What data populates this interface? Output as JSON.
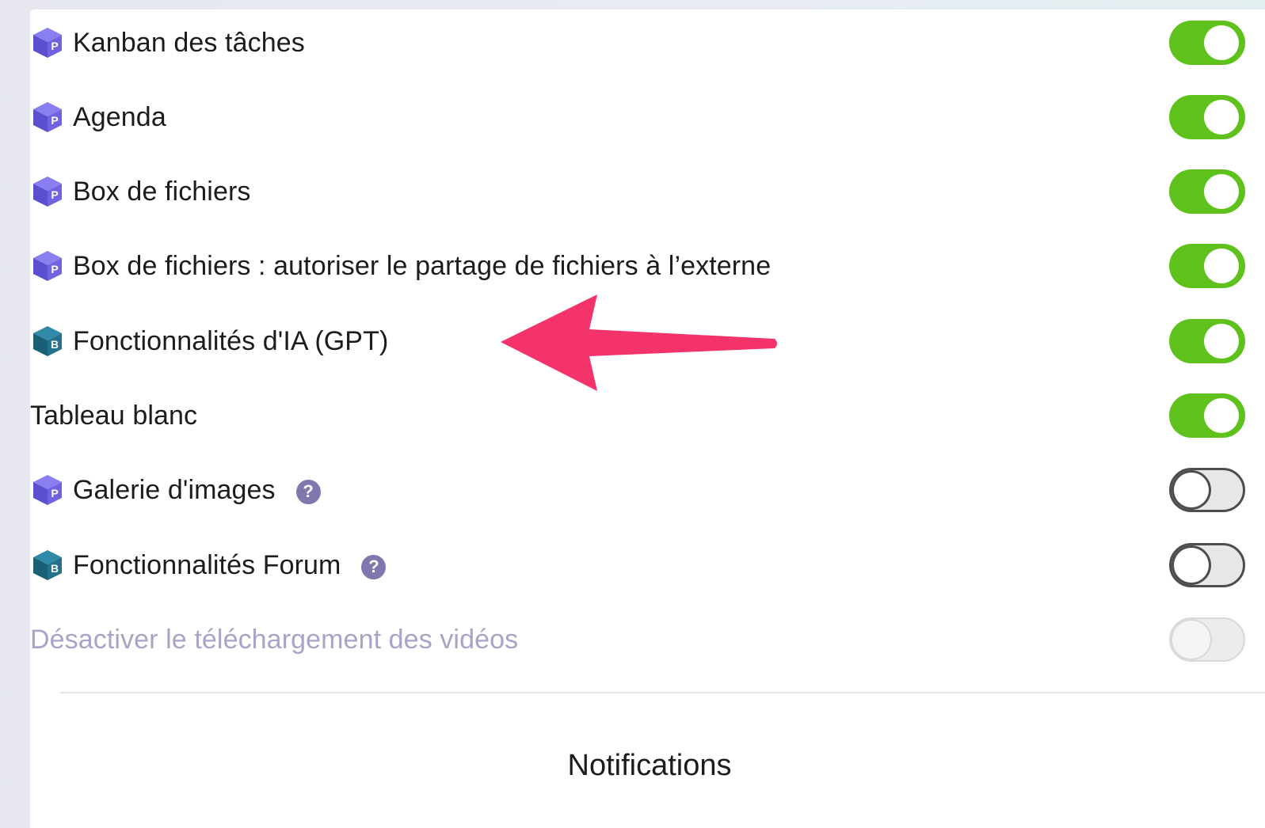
{
  "settings": {
    "items": [
      {
        "label": "Kanban des tâches",
        "icon": "purple-cube-icon",
        "enabled": true
      },
      {
        "label": "Agenda",
        "icon": "purple-cube-icon",
        "enabled": true
      },
      {
        "label": "Box de fichiers",
        "icon": "purple-cube-icon",
        "enabled": true
      },
      {
        "label": "Box de fichiers : autoriser le partage de fichiers à l’externe",
        "icon": "purple-cube-icon",
        "enabled": true
      },
      {
        "label": "Fonctionnalités d'IA (GPT)",
        "icon": "teal-cube-icon",
        "enabled": true
      },
      {
        "label": "Tableau blanc",
        "icon": null,
        "enabled": true
      },
      {
        "label": "Galerie d'images",
        "icon": "purple-cube-icon",
        "enabled": false,
        "help": "?"
      },
      {
        "label": "Fonctionnalités Forum",
        "icon": "teal-cube-icon",
        "enabled": false,
        "help": "?"
      },
      {
        "label": "Désactiver le téléchargement des vidéos",
        "icon": null,
        "enabled": false,
        "disabled": true
      }
    ]
  },
  "notifications": {
    "title": "Notifications"
  },
  "colors": {
    "toggle_on": "#5fc21c",
    "purple_cube": "#6b5fd8",
    "teal_cube": "#1f6e86",
    "arrow": "#f5336b",
    "disabled_text": "#a9a3c8"
  }
}
